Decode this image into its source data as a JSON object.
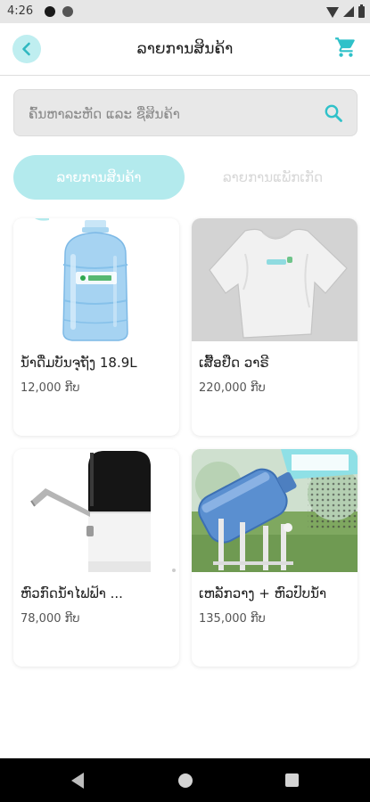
{
  "status_bar": {
    "time": "4:26"
  },
  "app_bar": {
    "title": "ລາຍການສິນຄ້າ",
    "back_icon": "chevron-left-icon",
    "cart_icon": "shopping-cart-icon"
  },
  "search": {
    "placeholder": "ຄົ້ນຫາລະຫັດ ແລະ ຊື່ສິນຄ້າ",
    "value": "",
    "icon": "search-icon"
  },
  "tabs": [
    {
      "label": "ລາຍການສິນຄ້າ",
      "active": true
    },
    {
      "label": "ລາຍການແພັກເກັດ",
      "active": false
    }
  ],
  "products": [
    {
      "name": "ນ້ຳດື່ມບັນຈຸຖັງ 18.9L",
      "price": "12,000 ກີບ",
      "image": "water-bottle-image"
    },
    {
      "name": "ເສື້ອຢືດ ວາຣີ",
      "price": "220,000 ກີບ",
      "image": "white-tshirt-image"
    },
    {
      "name": "ຫົວກົດນ້ຳໄຟຟ້າ ...",
      "price": "78,000 ກີບ",
      "image": "electric-water-pump-image"
    },
    {
      "name": "ເຫລັກວາງ + ຫົວປົບນ້ຳ",
      "price": "135,000 ກີບ",
      "image": "bottle-stand-image"
    }
  ],
  "colors": {
    "accent": "#2fc1c9",
    "accent_light": "#b3eaed",
    "status_bar": "#e6e6e6",
    "nav_bar": "#000000"
  }
}
